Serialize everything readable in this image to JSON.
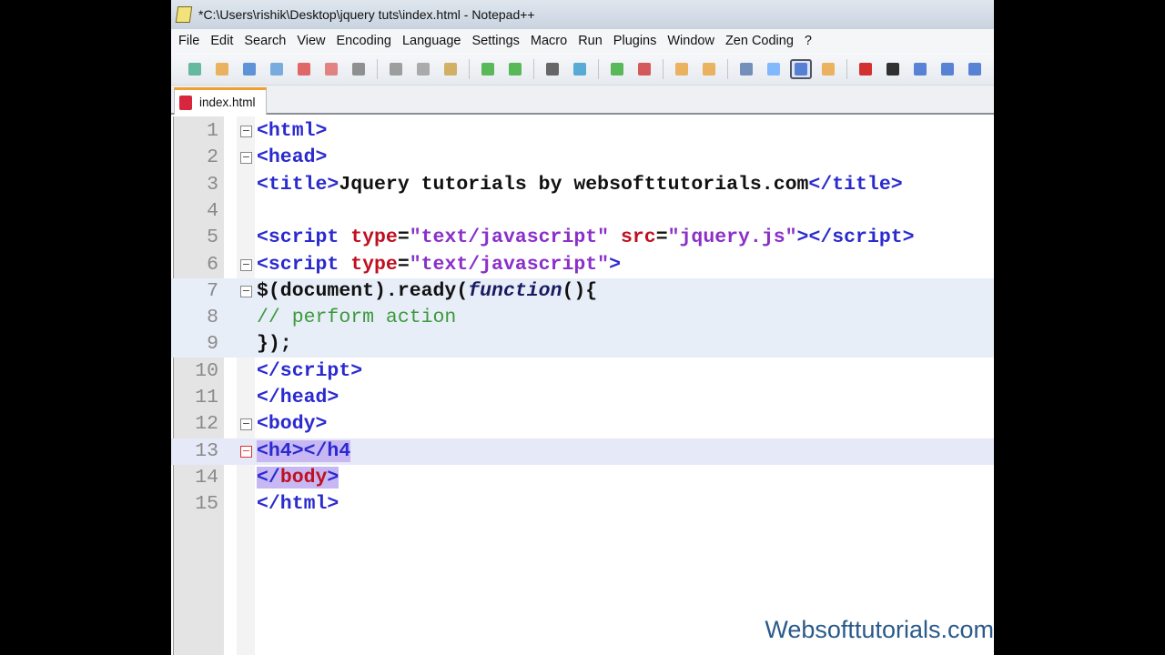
{
  "window": {
    "title": "*C:\\Users\\rishik\\Desktop\\jquery tuts\\index.html - Notepad++"
  },
  "menu": [
    "File",
    "Edit",
    "Search",
    "View",
    "Encoding",
    "Language",
    "Settings",
    "Macro",
    "Run",
    "Plugins",
    "Window",
    "Zen Coding",
    "?"
  ],
  "toolbar_icons": [
    "new-file",
    "open",
    "save",
    "save-all",
    "close",
    "close-all",
    "print",
    "cut",
    "copy",
    "paste",
    "undo",
    "redo",
    "find",
    "replace",
    "zoom-in",
    "zoom-out",
    "sync-v",
    "sync-h",
    "wrap",
    "show-all",
    "indent-guide",
    "udl",
    "record",
    "stop",
    "play",
    "play-multi",
    "save-macro"
  ],
  "tab": {
    "label": "index.html"
  },
  "lines": [
    {
      "n": "1",
      "fold": "minus",
      "tokens": [
        [
          "t",
          "<html>"
        ]
      ]
    },
    {
      "n": "2",
      "fold": "minus",
      "tokens": [
        [
          "t",
          "<head>"
        ]
      ]
    },
    {
      "n": "3",
      "tokens": [
        [
          "t",
          "<title>"
        ],
        [
          "p",
          "Jquery tutorials by websofttutorials.com"
        ],
        [
          "t",
          "</title>"
        ]
      ]
    },
    {
      "n": "4",
      "tokens": []
    },
    {
      "n": "5",
      "tokens": [
        [
          "t",
          "<script "
        ],
        [
          "a",
          "type"
        ],
        [
          "p",
          "="
        ],
        [
          "s",
          "\"text/javascript\""
        ],
        [
          "p",
          " "
        ],
        [
          "a",
          "src"
        ],
        [
          "p",
          "="
        ],
        [
          "s",
          "\"jquery.js\""
        ],
        [
          "t",
          "></script>"
        ]
      ]
    },
    {
      "n": "6",
      "fold": "minus",
      "tokens": [
        [
          "t",
          "<script "
        ],
        [
          "a",
          "type"
        ],
        [
          "p",
          "="
        ],
        [
          "s",
          "\"text/javascript\""
        ],
        [
          "t",
          ">"
        ]
      ]
    },
    {
      "n": "7",
      "fold": "minus",
      "hl": true,
      "tokens": [
        [
          "p",
          "$(document).ready("
        ],
        [
          "i",
          "function"
        ],
        [
          "p",
          "(){"
        ]
      ]
    },
    {
      "n": "8",
      "hl": true,
      "tokens": [
        [
          "c",
          "// perform action"
        ]
      ]
    },
    {
      "n": "9",
      "hl": true,
      "tokens": [
        [
          "p",
          "});"
        ]
      ]
    },
    {
      "n": "10",
      "tokens": [
        [
          "t",
          "</script>"
        ]
      ]
    },
    {
      "n": "11",
      "tokens": [
        [
          "t",
          "</head>"
        ]
      ]
    },
    {
      "n": "12",
      "fold": "minus",
      "tokens": [
        [
          "t",
          "<body>"
        ]
      ]
    },
    {
      "n": "13",
      "fold": "red",
      "cur": true,
      "tokens": [
        [
          "t sel",
          "<h4></h4"
        ]
      ]
    },
    {
      "n": "14",
      "tokens": [
        [
          "t sel",
          "</"
        ],
        [
          "a sel",
          "body"
        ],
        [
          "t sel",
          ">"
        ]
      ]
    },
    {
      "n": "15",
      "tokens": [
        [
          "t",
          "</html>"
        ]
      ]
    }
  ],
  "watermark": "Websofttutorials.com"
}
